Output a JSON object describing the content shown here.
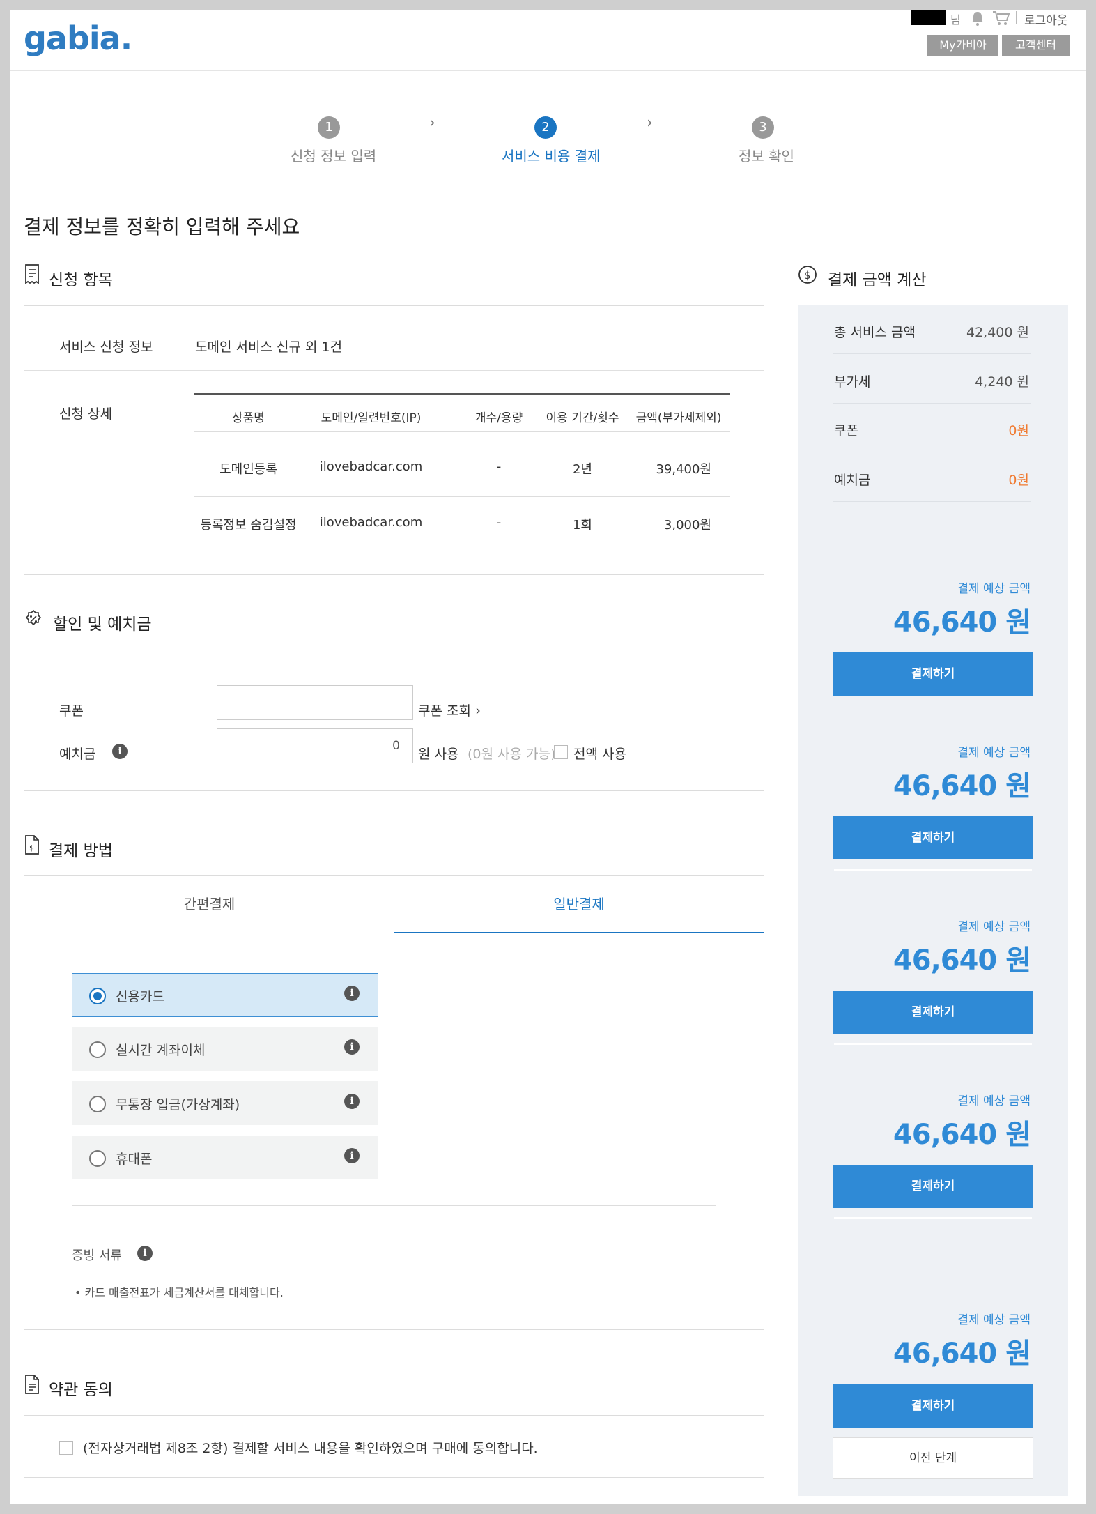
{
  "header": {
    "logo": "gabia.",
    "user_suffix": "님",
    "logout": "로그아웃",
    "my_gabia": "My가비아",
    "support": "고객센터"
  },
  "steps": [
    {
      "num": "1",
      "label": "신청 정보 입력"
    },
    {
      "num": "2",
      "label": "서비스 비용 결제"
    },
    {
      "num": "3",
      "label": "정보 확인"
    }
  ],
  "page_title": "결제 정보를 정확히 입력해 주세요",
  "application": {
    "title": "신청 항목",
    "info_label": "서비스 신청 정보",
    "info_value": "도메인 서비스 신규 외 1건",
    "detail_label": "신청 상세",
    "columns": [
      "상품명",
      "도메인/일련번호(IP)",
      "개수/용량",
      "이용 기간/횟수",
      "금액(부가세제외)"
    ],
    "rows": [
      [
        "도메인등록",
        "ilovebadcar.com",
        "-",
        "2년",
        "39,400원"
      ],
      [
        "등록정보 숨김설정",
        "ilovebadcar.com",
        "-",
        "1회",
        "3,000원"
      ]
    ]
  },
  "discount": {
    "title": "할인 및 예치금",
    "coupon_label": "쿠폰",
    "coupon_value": "",
    "coupon_lookup": "쿠폰 조회",
    "deposit_label": "예치금",
    "deposit_value": "0",
    "deposit_unit": "원 사용",
    "deposit_available": "(0원 사용 가능)",
    "use_all": "전액 사용"
  },
  "payment": {
    "title": "결제 방법",
    "tabs": [
      "간편결제",
      "일반결제"
    ],
    "methods": [
      "신용카드",
      "실시간 계좌이체",
      "무통장 입금(가상계좌)",
      "휴대폰"
    ],
    "proof_label": "증빙 서류",
    "proof_note": "• 카드 매출전표가 세금계산서를 대체합니다."
  },
  "terms": {
    "title": "약관 동의",
    "agree_text": "(전자상거래법 제8조 2항) 결제할 서비스 내용을 확인하였으며 구매에 동의합니다."
  },
  "summary": {
    "title": "결제 금액 계산",
    "rows": [
      {
        "label": "총 서비스 금액",
        "value": "42,400 원"
      },
      {
        "label": "부가세",
        "value": "4,240 원"
      },
      {
        "label": "쿠폰",
        "value": "0원"
      },
      {
        "label": "예치금",
        "value": "0원"
      }
    ],
    "estimate_label": "결제 예상 금액",
    "estimate_amount": "46,640 원",
    "pay_button": "결제하기",
    "prev_button": "이전 단계"
  },
  "colors": {
    "accent": "#2f8ad6",
    "step_active": "#1a75c2",
    "orange": "#f07a30"
  }
}
